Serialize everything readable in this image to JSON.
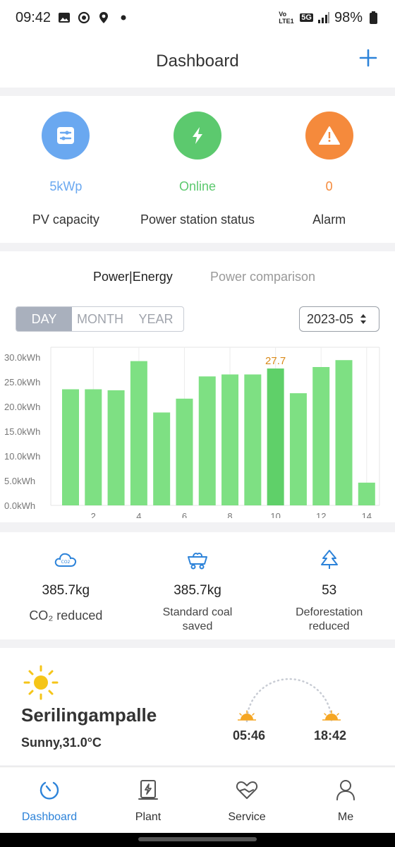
{
  "status": {
    "time": "09:42",
    "network": "5G",
    "lte": "Vo LTE1",
    "battery": "98%"
  },
  "header": {
    "title": "Dashboard"
  },
  "stats": [
    {
      "value": "5kWp",
      "label": "PV capacity",
      "color": "#6aa8f0",
      "icon": "sliders-icon"
    },
    {
      "value": "Online",
      "label": "Power station status",
      "color": "#5cc96e",
      "icon": "bolt-icon"
    },
    {
      "value": "0",
      "label": "Alarm",
      "color": "#f58a3c",
      "icon": "warning-icon"
    }
  ],
  "chart_tabs": {
    "active": "Power|Energy",
    "inactive": "Power comparison"
  },
  "period": {
    "day": "DAY",
    "month": "MONTH",
    "year": "YEAR",
    "selected": "DAY"
  },
  "date": {
    "value": "2023-05"
  },
  "chart_data": {
    "type": "bar",
    "x": [
      1,
      2,
      3,
      4,
      5,
      6,
      7,
      8,
      9,
      10,
      11,
      12,
      13,
      14
    ],
    "values": [
      23.5,
      23.5,
      23.3,
      29.2,
      18.8,
      21.6,
      26.1,
      26.5,
      26.5,
      27.7,
      22.7,
      28.0,
      29.4,
      4.6
    ],
    "highlight_index": 9,
    "highlight_label": "27.7",
    "y_ticks": [
      "0.0kWh",
      "5.0kWh",
      "10.0kWh",
      "15.0kWh",
      "20.0kWh",
      "25.0kWh",
      "30.0kWh"
    ],
    "x_ticks": [
      "2",
      "4",
      "6",
      "8",
      "10",
      "12",
      "14"
    ],
    "ylim": [
      0,
      32
    ],
    "colors": {
      "bar": "#7ee083",
      "highlight": "#5fd069",
      "label": "#d98a1a"
    }
  },
  "eco": [
    {
      "value": "385.7kg",
      "label": "CO₂ reduced",
      "icon": "co2-cloud-icon"
    },
    {
      "value": "385.7kg",
      "label": "Standard coal saved",
      "icon": "coal-cart-icon"
    },
    {
      "value": "53",
      "label": "Deforestation reduced",
      "icon": "tree-icon"
    }
  ],
  "weather": {
    "city": "Serilingampalle",
    "condition": "Sunny,31.0°C",
    "sunrise": "05:46",
    "sunset": "18:42"
  },
  "tabs": [
    {
      "label": "Dashboard",
      "icon": "dashboard-icon",
      "active": true
    },
    {
      "label": "Plant",
      "icon": "plant-icon",
      "active": false
    },
    {
      "label": "Service",
      "icon": "service-icon",
      "active": false
    },
    {
      "label": "Me",
      "icon": "user-icon",
      "active": false
    }
  ]
}
